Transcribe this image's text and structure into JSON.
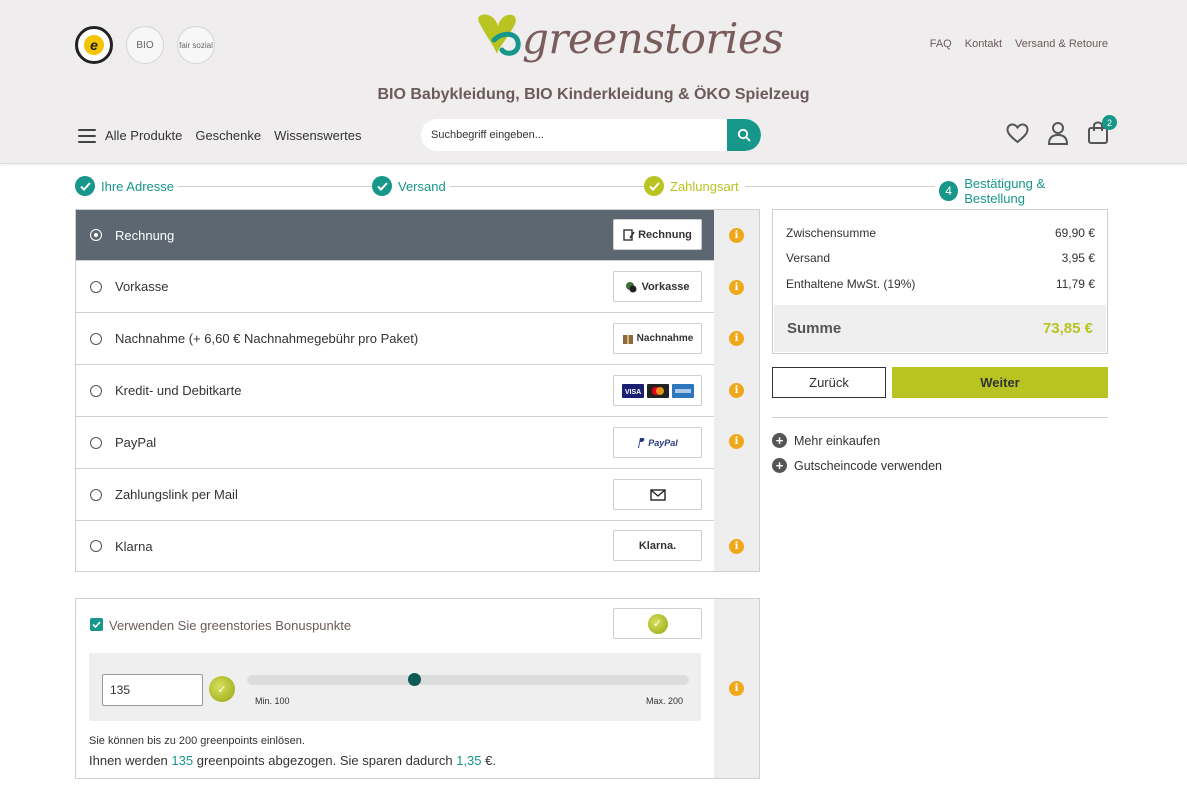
{
  "header": {
    "brand": "greenstories",
    "tagline": "BIO Babykleidung, BIO Kinderkleidung & ÖKO Spielzeug",
    "badges": [
      "trusted-shops-badge",
      "bio-badge",
      "fair-sozial-badge"
    ],
    "badge_bio": "BIO",
    "badge_fair": "fair sozial",
    "badge_te": "e",
    "top_links": [
      "FAQ",
      "Kontakt",
      "Versand & Retoure"
    ],
    "nav": [
      "Alle Produkte",
      "Geschenke",
      "Wissenswertes"
    ],
    "search_placeholder": "Suchbegriff eingeben...",
    "cart_count": "2"
  },
  "steps": [
    {
      "label": "Ihre Adresse",
      "state": "done"
    },
    {
      "label": "Versand",
      "state": "done"
    },
    {
      "label": "Zahlungsart",
      "state": "current"
    },
    {
      "label": "Bestätigung & Bestellung",
      "state": "pending",
      "number": "4"
    }
  ],
  "payment_methods": [
    {
      "label": "Rechnung",
      "logo": "Rechnung",
      "selected": true,
      "info": true
    },
    {
      "label": "Vorkasse",
      "logo": "Vorkasse",
      "selected": false,
      "info": true
    },
    {
      "label": "Nachnahme (+ 6,60 € Nachnahmegebühr pro Paket)",
      "logo": "Nachnahme",
      "selected": false,
      "info": true
    },
    {
      "label": "Kredit- und Debitkarte",
      "logo": "card-logos",
      "selected": false,
      "info": true
    },
    {
      "label": "PayPal",
      "logo": "PayPal",
      "selected": false,
      "info": true
    },
    {
      "label": "Zahlungslink per Mail",
      "logo": "mail-icon",
      "selected": false,
      "info": false
    },
    {
      "label": "Klarna",
      "logo": "Klarna.",
      "selected": false,
      "info": true
    }
  ],
  "bonus": {
    "checked": true,
    "label": "Verwenden Sie greenstories Bonuspunkte",
    "points_value": "135",
    "slider_min": 100,
    "slider_max": 200,
    "slider_value": 135,
    "min_label": "Min. 100",
    "max_label": "Max. 200",
    "note": "Sie können bis zu 200 greenpoints einlösen.",
    "result_prefix": "Ihnen werden ",
    "result_points": "135",
    "result_mid": " greenpoints abgezogen. Sie sparen dadurch ",
    "result_amount": "1,35",
    "result_suffix": " €."
  },
  "summary": {
    "rows": [
      {
        "label": "Zwischensumme",
        "value": "69,90 €"
      },
      {
        "label": "Versand",
        "value": "3,95 €"
      },
      {
        "label": "Enthaltene MwSt. (19%)",
        "value": "11,79 €"
      }
    ],
    "total_label": "Summe",
    "total_value": "73,85 €"
  },
  "actions": {
    "back": "Zurück",
    "next": "Weiter",
    "more_shopping": "Mehr einkaufen",
    "voucher": "Gutscheincode verwenden"
  },
  "colors": {
    "teal": "#17968a",
    "lime": "#b9c423",
    "selected_row": "#5d6771",
    "info": "#f0a81b"
  }
}
